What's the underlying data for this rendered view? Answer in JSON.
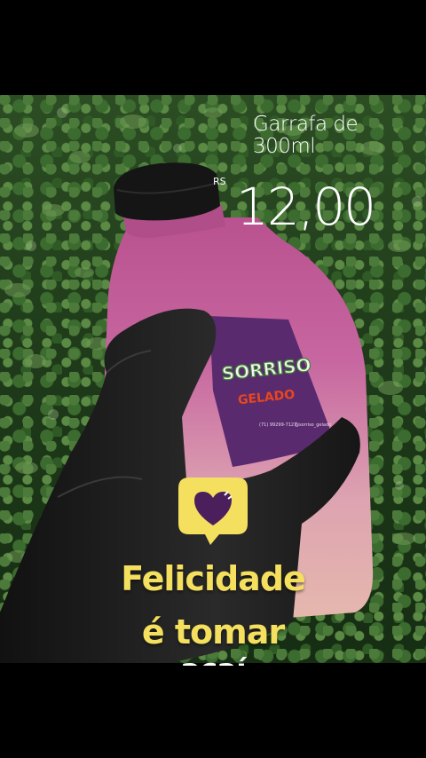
{
  "post": {
    "product_name": "Garrafa de 300ml",
    "currency": "RS",
    "price": "12,00",
    "headline_line1": "Felicidade",
    "headline_line2": "é tomar",
    "headline_cut": "açaí"
  },
  "label": {
    "brand_top": "SORRISO",
    "brand_bottom": "GELADO",
    "phone": "(71) 99299-7127",
    "handle": "@sorriso_gelado"
  },
  "colors": {
    "accent_yellow": "#f4df5e",
    "label_purple": "#5a2a6e",
    "drink_pink": "#c766a0"
  },
  "icons": [
    "heart-speech-bubble-icon"
  ]
}
